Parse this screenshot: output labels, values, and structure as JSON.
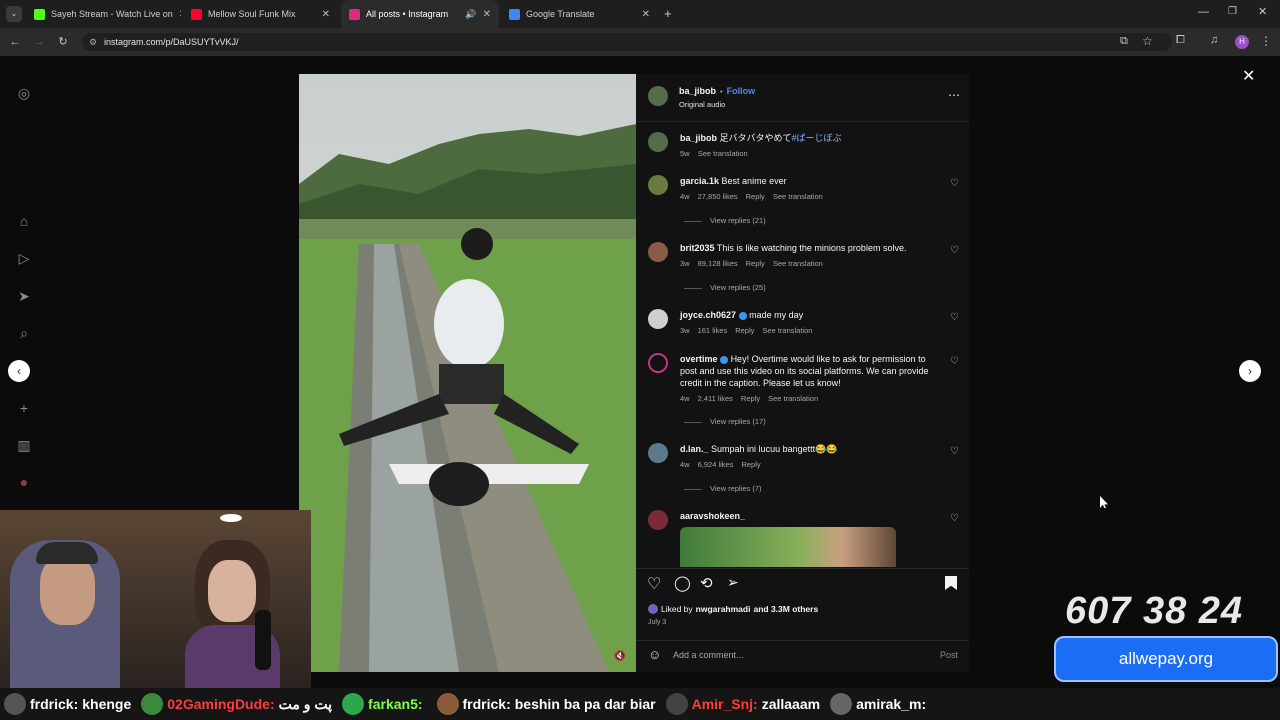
{
  "tabs": [
    {
      "title": "Sayeh Stream - Watch Live on",
      "fav_color": "#53fc18"
    },
    {
      "title": "Mellow Soul Funk Mix",
      "fav_color": "#ff0033"
    },
    {
      "title": "All posts • Instagram",
      "fav_color": "#dd2a7b"
    },
    {
      "title": "Google Translate",
      "fav_color": "#4285f4"
    }
  ],
  "address": {
    "url": "instagram.com/p/DaUSUYTvVKJ/"
  },
  "post": {
    "author": "ba_jibob",
    "follow_label": "Follow",
    "audio": "Original audio",
    "caption_user": "ba_jibob",
    "caption_text": "足バタバタやめて",
    "caption_tag": "#ばーじぼぶ",
    "caption_time": "5w",
    "see_translation": "See translation",
    "liked_by_prefix": "Liked by",
    "liked_by_user": "nwgarahmadi",
    "liked_by_suffix": "and 3.3M others",
    "date": "July 3",
    "add_comment": "Add a comment...",
    "post_label": "Post"
  },
  "comments": [
    {
      "user": "garcia.1k",
      "text": "Best anime ever",
      "time": "4w",
      "likes": "27,850 likes",
      "reply": "Reply",
      "translate": "See translation",
      "replies": "View replies (21)"
    },
    {
      "user": "brit2035",
      "text": "This is like watching the minions problem solve.",
      "time": "3w",
      "likes": "89,128 likes",
      "reply": "Reply",
      "translate": "See translation",
      "replies": "View replies (25)"
    },
    {
      "user": "joyce.ch0627",
      "text": "made my day",
      "time": "3w",
      "likes": "161 likes",
      "reply": "Reply",
      "translate": "See translation",
      "replies": ""
    },
    {
      "user": "overtime",
      "text": "Hey! Overtime would like to ask for permission to post and use this video on its social platforms. We can provide credit in the caption. Please let us know!",
      "time": "4w",
      "likes": "2,411 likes",
      "reply": "Reply",
      "translate": "See translation",
      "replies": "View replies (17)"
    },
    {
      "user": "d.lan._",
      "text": "Sumpah ini lucuu bangettt😂😂",
      "time": "4w",
      "likes": "6,924 likes",
      "reply": "Reply",
      "translate": "",
      "replies": "View replies (7)"
    },
    {
      "user": "aaravshokeen_",
      "text": "",
      "time": "",
      "likes": "",
      "reply": "",
      "translate": "",
      "replies": ""
    }
  ],
  "overlay": {
    "timer": "607 38 24",
    "promo": "allwepay.org"
  },
  "chat": [
    {
      "name": "frdrick:",
      "msg": "khenge",
      "color": "#ffffff"
    },
    {
      "name": "02GamingDude:",
      "msg": "پت و مت",
      "color": "#ff3b3b"
    },
    {
      "name": "farkan5:",
      "msg": "",
      "color": "#7bff4a"
    },
    {
      "name": "frdrick:",
      "msg": "beshin ba pa dar biar",
      "color": "#ffffff"
    },
    {
      "name": "Amir_Snj:",
      "msg": "zallaaam",
      "color": "#ff3b3b"
    },
    {
      "name": "amirak_m:",
      "msg": "",
      "color": "#ffffff"
    }
  ]
}
